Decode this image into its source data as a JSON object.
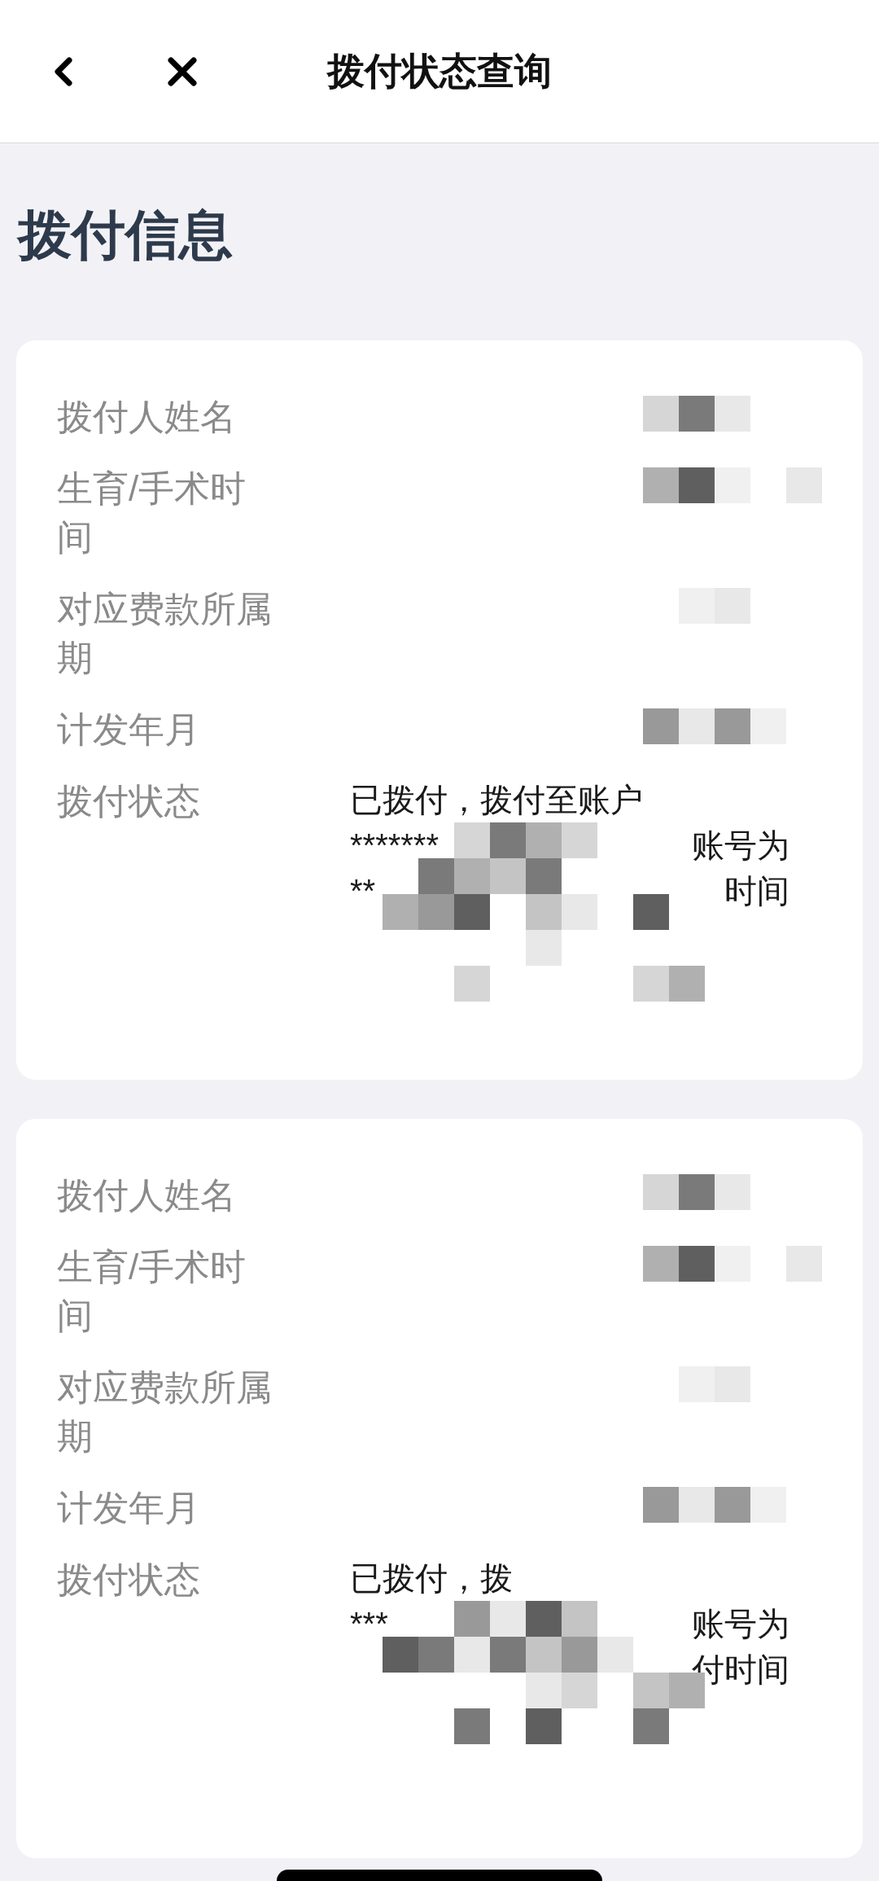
{
  "header": {
    "title": "拨付状态查询"
  },
  "section_title": "拨付信息",
  "cards": [
    {
      "rows": [
        {
          "label": "拨付人姓名"
        },
        {
          "label": "生育/手术时间"
        },
        {
          "label": "对应费款所属期"
        },
        {
          "label": "计发年月"
        }
      ],
      "status": {
        "label": "拨付状态",
        "lines": [
          {
            "segments": [
              "已拨付，拨付至账户"
            ]
          },
          {
            "segments": [
              "*******",
              "账号为"
            ]
          },
          {
            "segments": [
              "**",
              "时间"
            ]
          }
        ]
      }
    },
    {
      "rows": [
        {
          "label": "拨付人姓名"
        },
        {
          "label": "生育/手术时间"
        },
        {
          "label": "对应费款所属期"
        },
        {
          "label": "计发年月"
        }
      ],
      "status": {
        "label": "拨付状态",
        "lines": [
          {
            "segments": [
              "已拨付，拨"
            ]
          },
          {
            "segments": [
              "***",
              "账号为"
            ]
          },
          {
            "segments": [
              "付时间"
            ]
          }
        ]
      }
    }
  ]
}
